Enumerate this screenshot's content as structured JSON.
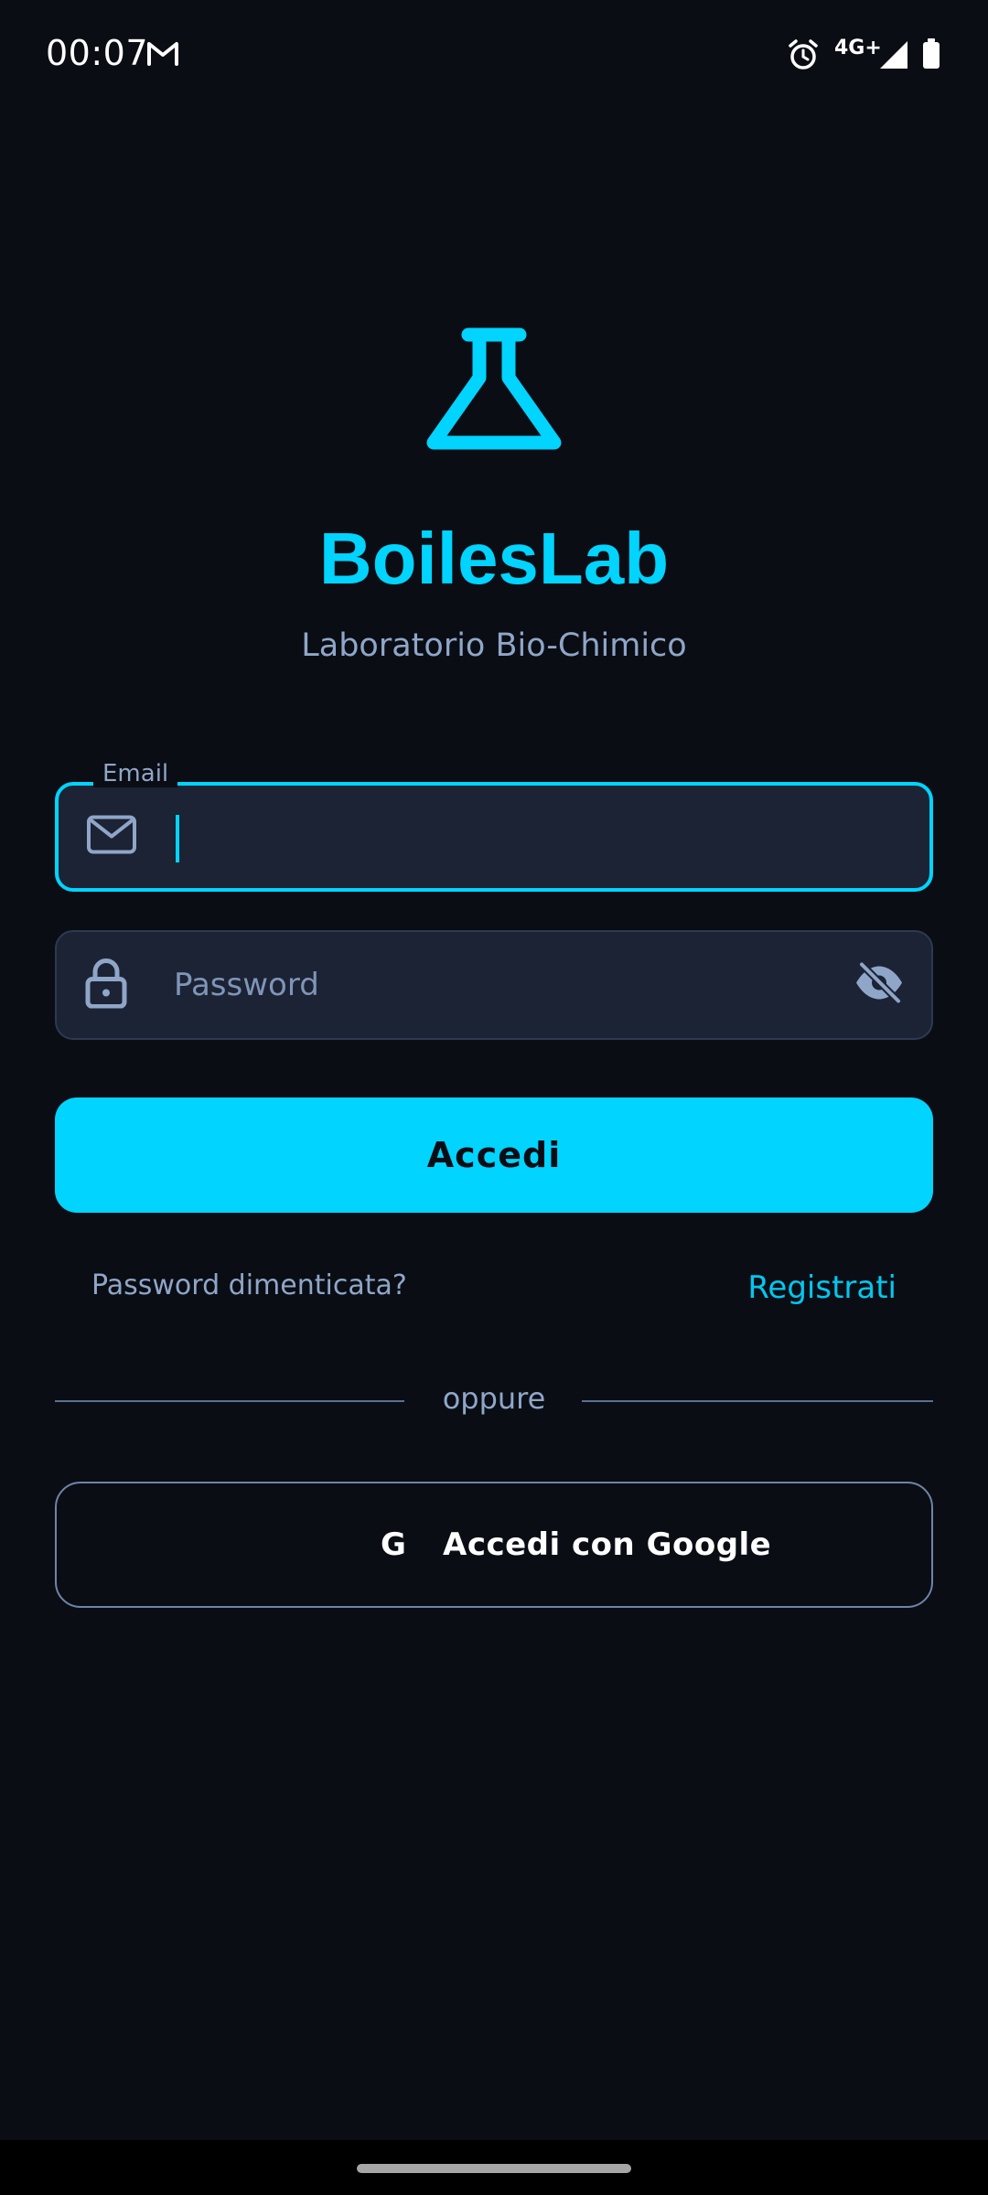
{
  "status_bar": {
    "time": "00:07",
    "network": "4G+",
    "icons": [
      "gmail-icon",
      "alarm-icon",
      "signal-icon",
      "battery-icon"
    ]
  },
  "app": {
    "logo_icon": "flask-icon",
    "title": "BoilesLab",
    "subtitle": "Laboratorio Bio-Chimico"
  },
  "form": {
    "email": {
      "label": "Email",
      "value": "",
      "icon": "mail-icon",
      "focused": true
    },
    "password": {
      "placeholder": "Password",
      "value": "",
      "icon": "lock-icon",
      "toggle_icon": "eye-off-icon"
    },
    "login_button": "Accedi",
    "forgot_password": "Password dimenticata?",
    "register": "Registrati",
    "divider": "oppure",
    "google_button": {
      "icon_text": "G",
      "label": "Accedi con Google"
    }
  },
  "colors": {
    "background": "#0a0d14",
    "accent": "#00d4ff",
    "field_background": "#1c2334",
    "muted_text": "#8fa6c8"
  }
}
